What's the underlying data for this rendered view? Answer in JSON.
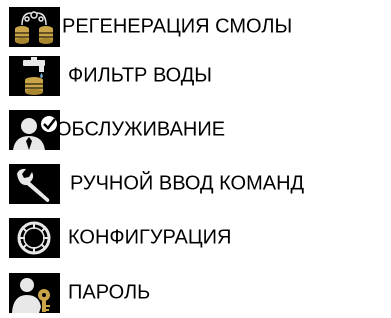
{
  "menu": {
    "items": [
      {
        "label": "РЕГЕНЕРАЦИЯ СМОЛЫ",
        "icon": "resin-regeneration-icon"
      },
      {
        "label": "ФИЛЬТР ВОДЫ",
        "icon": "water-filter-icon"
      },
      {
        "label": "ОБСЛУЖИВАНИЕ",
        "icon": "maintenance-icon"
      },
      {
        "label": "РУЧНОЙ ВВОД КОМАНД",
        "icon": "wrench-icon"
      },
      {
        "label": "КОНФИГУРАЦИЯ",
        "icon": "gear-icon"
      },
      {
        "label": "ПАРОЛЬ",
        "icon": "user-key-icon"
      }
    ]
  },
  "colors": {
    "icon_background": "#000000",
    "icon_accent": "#c9a449",
    "icon_light": "#e8e8e8",
    "text": "#000000"
  }
}
